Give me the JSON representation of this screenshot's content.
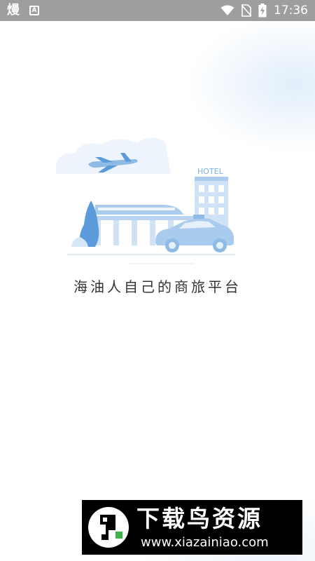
{
  "status_bar": {
    "app_icon_glyph": "熳",
    "a_badge": "A",
    "time": "17:36",
    "icons": [
      "wifi-icon",
      "no-sim-icon",
      "battery-charging-icon"
    ]
  },
  "illustration": {
    "hotel_sign": "HOTEL",
    "items": [
      "airplane-illustration",
      "train-illustration",
      "hotel-building-illustration",
      "taxi-car-illustration",
      "cloud-illustration",
      "tree-illustration"
    ]
  },
  "slogan": "海油人自己的商旅平台",
  "watermark": {
    "title": "下载鸟资源",
    "url": "www.xiazainiao.com"
  },
  "colors": {
    "status_bar": "#9e9e9e",
    "illustration_blue": "#a9cbee",
    "illustration_dark_blue": "#5b9bd9",
    "text": "#333333"
  }
}
